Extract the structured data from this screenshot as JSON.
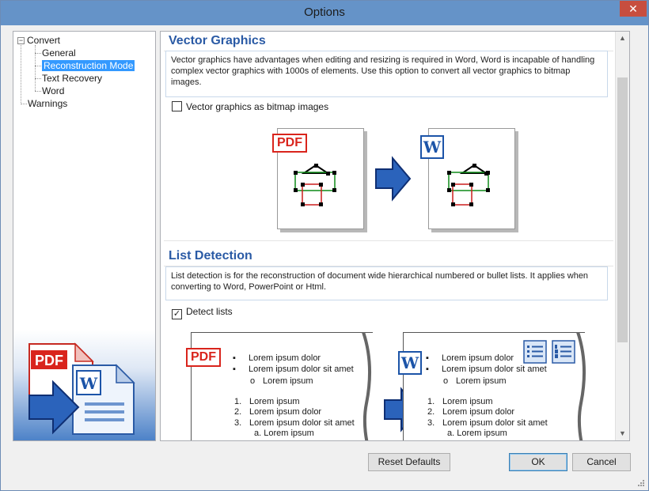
{
  "window": {
    "title": "Options",
    "close_glyph": "✕"
  },
  "tree": {
    "root_label": "Convert",
    "children": [
      "General",
      "Reconstruction Mode",
      "Text Recovery",
      "Word"
    ],
    "selected_index": 1,
    "second_root": "Warnings",
    "toggle_glyph": "−"
  },
  "vector": {
    "title": "Vector Graphics",
    "description": "Vector graphics have advantages when editing and resizing is required in Word, Word is incapable of handling complex vector graphics with 1000s of elements. Use this option to convert all vector graphics to bitmap images.",
    "checkbox_label": "Vector graphics as bitmap images",
    "checked": false,
    "pdf_badge": "PDF",
    "word_badge": "W"
  },
  "lists": {
    "title": "List Detection",
    "description": "List detection is for the reconstruction of document wide hierarchical numbered or bullet lists. It applies when converting to Word, PowerPoint or Html.",
    "checkbox_label": "Detect lists",
    "checked": true,
    "check_glyph": "✓",
    "pdf_badge": "PDF",
    "word_badge": "W",
    "bullet1": "Lorem ipsum dolor",
    "bullet2": "Lorem ipsum dolor sit amet",
    "sub_bullet": "Lorem ipsum",
    "num1": "Lorem ipsum",
    "num2": "Lorem ipsum dolor",
    "num3": "Lorem ipsum dolor sit amet",
    "sub_num": "a. Lorem ipsum",
    "marker_1": "1.",
    "marker_2": "2.",
    "marker_3": "3.",
    "bullet_glyph": "▪",
    "sub_bullet_glyph": "o"
  },
  "buttons": {
    "reset": "Reset Defaults",
    "ok": "OK",
    "cancel": "Cancel"
  },
  "logo": {
    "pdf_text": "PDF",
    "word_text": "W"
  },
  "colors": {
    "accent": "#2a5aa5",
    "titlebar": "#6593c8",
    "pdf_red": "#d9241c",
    "word_blue": "#1c54a8",
    "selection": "#3399ff"
  }
}
